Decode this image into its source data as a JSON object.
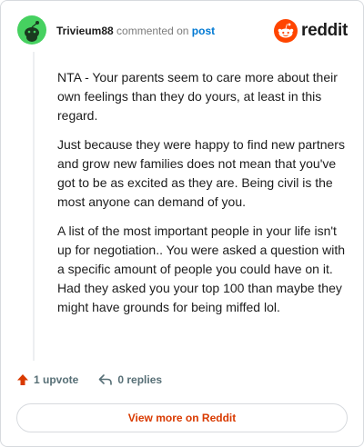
{
  "header": {
    "username": "Trivieum88",
    "commented_text": "commented on",
    "post_link": "post"
  },
  "brand": {
    "logo_text": "reddit",
    "logo_icon": "reddit-snoo-icon",
    "accent_color": "#ff4500"
  },
  "avatar": {
    "icon": "snoo-avatar-icon",
    "color": "#46d160"
  },
  "comment": {
    "paragraphs": [
      "NTA - Your parents seem to care more about their own feelings than they do yours, at least in this regard.",
      "Just because they were happy to find new partners and grow new families does not mean that you've got to be as excited as they are. Being civil is the most anyone can demand of you.",
      "A list of the most important people in your life isn't up for negotiation.. You were asked a question with a specific amount of people you could have on it. Had they asked you your top 100 than maybe they might have grounds for being miffed lol."
    ]
  },
  "actions": {
    "upvote_label": "1 upvote",
    "replies_label": "0 replies"
  },
  "footer": {
    "view_more_label": "View more on Reddit"
  }
}
